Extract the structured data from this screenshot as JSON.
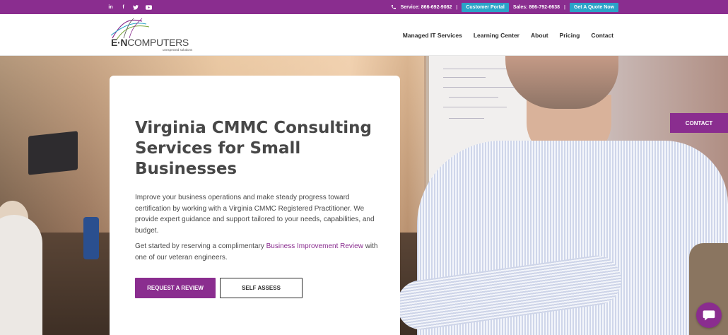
{
  "topbar": {
    "social": [
      {
        "label": "in",
        "icon": "linkedin-icon"
      },
      {
        "label": "f",
        "icon": "facebook-icon"
      },
      {
        "label": "twitter",
        "icon": "twitter-icon"
      },
      {
        "label": "youtube",
        "icon": "youtube-icon"
      }
    ],
    "service_phone": "Service: 866-692-9082",
    "customer_portal": "Customer Portal",
    "sales_phone": "Sales: 866-792-6638",
    "quote_button": "Get A Quote Now",
    "separator": "|"
  },
  "header": {
    "logo": {
      "word_bold": "E·N",
      "word_rest": "COMPUTERS",
      "tagline": "unexpected solutions"
    },
    "nav": [
      "Managed IT Services",
      "Learning Center",
      "About",
      "Pricing",
      "Contact"
    ]
  },
  "hero": {
    "title": "Virginia CMMC Consulting Services for Small Businesses",
    "paragraph1": "Improve your business operations and make steady progress toward certification by working with a Virginia CMMC Registered Practitioner. We provide expert guidance and support tailored to your needs, capabilities, and budget.",
    "paragraph2_prefix": "Get started by reserving a complimentary ",
    "paragraph2_link": "Business Improvement Review",
    "paragraph2_suffix": " with one of our veteran engineers.",
    "primary_button": "REQUEST A REVIEW",
    "secondary_button": "SELF ASSESS"
  },
  "side_contact": "CONTACT",
  "colors": {
    "brand_purple": "#8a2d8f",
    "portal_blue": "#2aa3c8",
    "heading_gray": "#474747"
  }
}
